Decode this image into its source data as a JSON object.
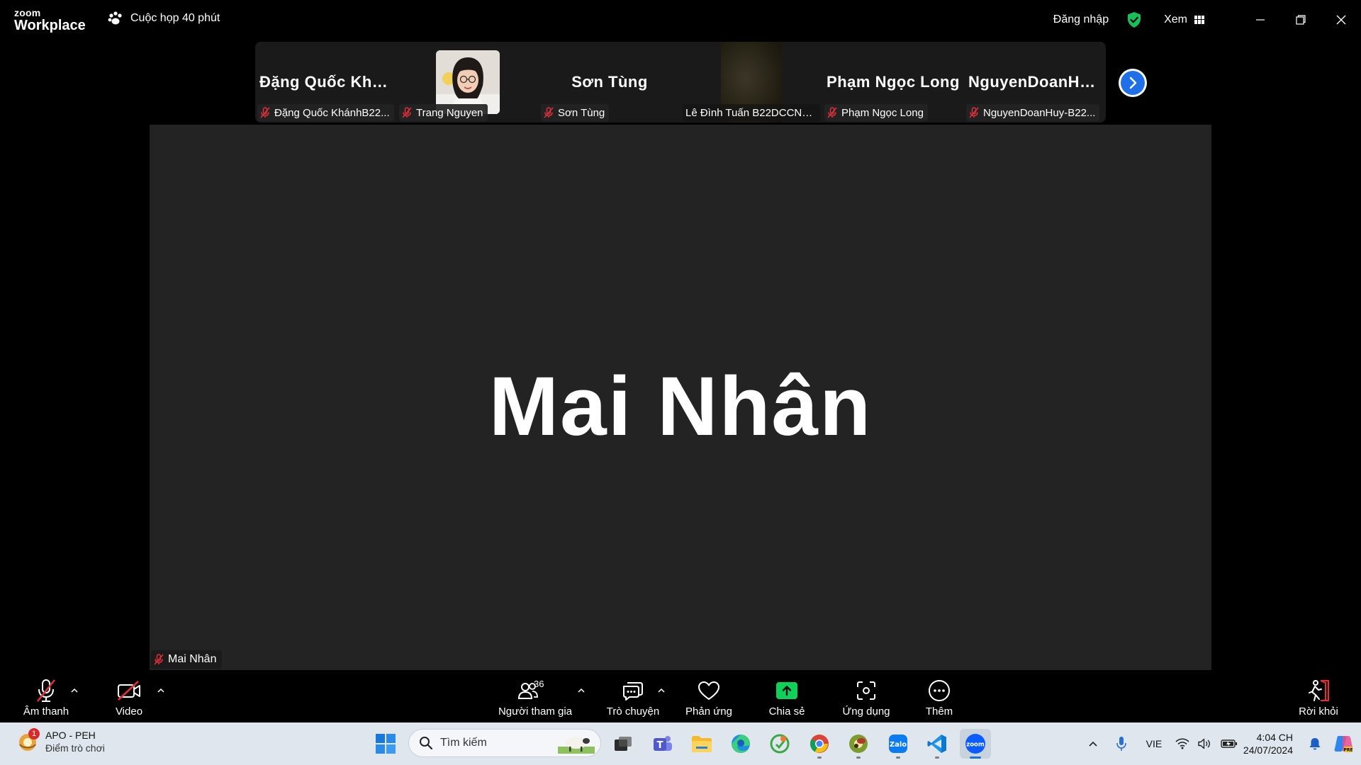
{
  "titlebar": {
    "logo_top": "zoom",
    "logo_bottom": "Workplace",
    "meeting_label": "Cuộc họp 40 phút",
    "signin_label": "Đăng nhập",
    "view_label": "Xem"
  },
  "participants": [
    {
      "display_name": "Đặng Quốc Khá...",
      "label": "Đặng Quốc KhánhB22...",
      "muted": true
    },
    {
      "display_name": "",
      "label": "Trang Nguyen",
      "muted": true,
      "has_photo": true
    },
    {
      "display_name": "Sơn Tùng",
      "label": "Sơn Tùng",
      "muted": true
    },
    {
      "display_name": "",
      "label": "Lê Đình Tuấn B22DCCN7...",
      "muted": false,
      "has_video": true
    },
    {
      "display_name": "Phạm Ngọc Long",
      "label": "Phạm Ngọc Long",
      "muted": true
    },
    {
      "display_name": "NguyenDoanHu...",
      "label": "NguyenDoanHuy-B22...",
      "muted": true
    }
  ],
  "main_video": {
    "speaker_name": "Mai Nhân",
    "label": "Mai Nhân"
  },
  "toolbar": {
    "audio_label": "Âm thanh",
    "video_label": "Video",
    "participants_label": "Người tham gia",
    "participants_count": "36",
    "chat_label": "Trò chuyện",
    "react_label": "Phản ứng",
    "share_label": "Chia sẻ",
    "apps_label": "Ứng dụng",
    "more_label": "Thêm",
    "leave_label": "Rời khỏi"
  },
  "taskbar": {
    "weather_badge": "1",
    "weather_title": "APO - PEH",
    "weather_subtitle": "Điểm trò chơi",
    "search_placeholder": "Tìm kiếm",
    "language": "VIE",
    "time": "4:04 CH",
    "date": "24/07/2024"
  },
  "colors": {
    "share_green": "#0fd15a",
    "accent_blue": "#1e6fe8",
    "muted_red": "#e0303a",
    "shield_green": "#18c05a"
  }
}
